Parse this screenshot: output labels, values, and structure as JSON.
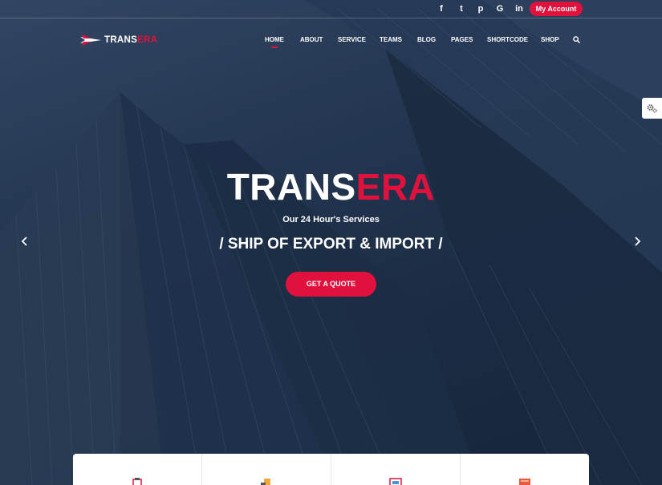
{
  "topbar": {
    "social": [
      {
        "name": "facebook",
        "glyph": "f"
      },
      {
        "name": "twitter",
        "glyph": "t"
      },
      {
        "name": "pinterest",
        "glyph": "p"
      },
      {
        "name": "google",
        "glyph": "G"
      },
      {
        "name": "linkedin",
        "glyph": "in"
      }
    ],
    "account_label": "My Account"
  },
  "logo": {
    "text_white": "TRANS",
    "text_red": "ERA"
  },
  "nav": {
    "items": [
      "HOME",
      "ABOUT",
      "SERVICE",
      "TEAMS",
      "BLOG",
      "PAGES",
      "SHORTCODE",
      "SHOP"
    ],
    "active": "HOME"
  },
  "hero": {
    "title_white": "TRANS",
    "title_red": "ERA",
    "subtitle": "Our 24 Hour's Services",
    "tagline": "/ SHIP OF EXPORT & IMPORT /",
    "cta_label": "GET A QUOTE"
  },
  "colors": {
    "accent": "#e0123d",
    "overlay": "#1e2e46"
  },
  "icons": [
    "search-icon",
    "settings-gear-icon",
    "arrow-left-icon",
    "arrow-right-icon"
  ]
}
